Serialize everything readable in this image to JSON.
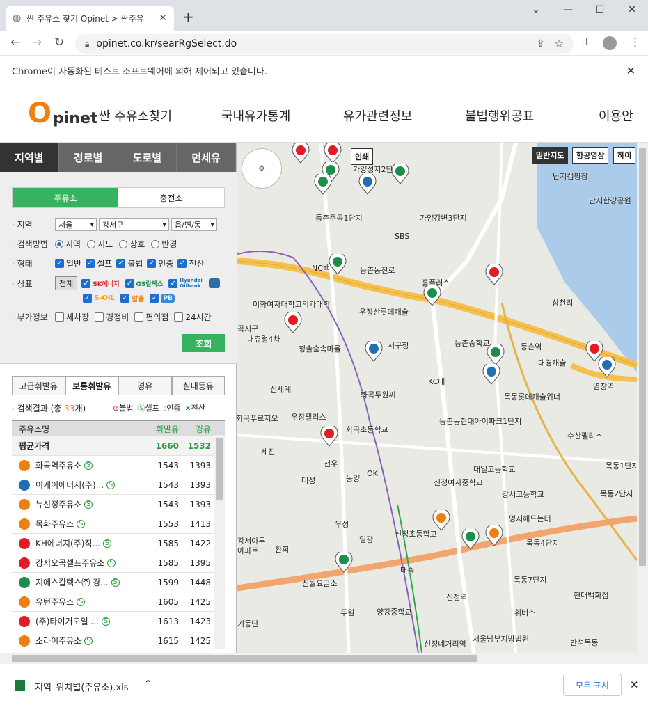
{
  "browser": {
    "tab_title": "싼 주유소 찾기 Opinet > 싼주유",
    "url": "opinet.co.kr/searRgSelect.do",
    "infobar": "Chrome이 자동화된 테스트 소프트웨어에 의해 제어되고 있습니다."
  },
  "header": {
    "logo_o": "O",
    "logo_rest": "pinet",
    "menu": [
      "싼 주유소찾기",
      "국내유가통계",
      "유가관련정보",
      "불법행위공표",
      "이용안"
    ]
  },
  "side": {
    "tabs": [
      "지역별",
      "경로별",
      "도로별",
      "면세유"
    ],
    "subtabs": [
      "주유소",
      "충전소"
    ],
    "region_label": "지역",
    "region_values": [
      "서울",
      "강서구",
      "읍/면/동"
    ],
    "method_label": "검색방법",
    "method_options": [
      "지역",
      "지도",
      "상호",
      "반경"
    ],
    "type_label": "형태",
    "type_options": [
      "일반",
      "셀프",
      "불법",
      "인증",
      "전산"
    ],
    "brand_label": "상표",
    "brand_all": "전체",
    "brands_row1": [
      "SK에너지",
      "GS칼텍스",
      "Hyundai Oilbank",
      ""
    ],
    "brands_row2": [
      "S-OIL",
      "알뜰",
      "PB"
    ],
    "extra_label": "부가정보",
    "extra_options": [
      "세차장",
      "경정비",
      "편의점",
      "24시간"
    ],
    "search_button": "조회",
    "fuel_tabs": [
      "고급휘발유",
      "보통휘발유",
      "경유",
      "실내등유"
    ],
    "result_prefix": "검색결과 (총 ",
    "result_count": "33",
    "result_suffix": "개)",
    "legend": [
      "불법",
      "셀프",
      "인증",
      "전산"
    ],
    "table_headers": [
      "주유소명",
      "휘발유",
      "경유"
    ],
    "avg_label": "평균가격",
    "avg_gas": "1660",
    "avg_diesel": "1532",
    "rows": [
      {
        "name": "화곡역주유소",
        "brand": "알뜰",
        "color": "#f07f11",
        "gas": "1543",
        "diesel": "1393"
      },
      {
        "name": "이케이에너지(주)...",
        "brand": "HD",
        "color": "#1f6fb2",
        "gas": "1543",
        "diesel": "1393"
      },
      {
        "name": "뉴신정주유소",
        "brand": "알뜰",
        "color": "#f07f11",
        "gas": "1543",
        "diesel": "1393"
      },
      {
        "name": "목화주유소",
        "brand": "알뜰",
        "color": "#f07f11",
        "gas": "1553",
        "diesel": "1413"
      },
      {
        "name": "KH에너지(주)직...",
        "brand": "SK",
        "color": "#e31b23",
        "gas": "1585",
        "diesel": "1422"
      },
      {
        "name": "강서오곡셀프주유소",
        "brand": "SK",
        "color": "#e31b23",
        "gas": "1585",
        "diesel": "1395"
      },
      {
        "name": "지에스칼텍스㈜ 경...",
        "brand": "GS",
        "color": "#1b8f4a",
        "gas": "1599",
        "diesel": "1448"
      },
      {
        "name": "유턴주유소",
        "brand": "알뜰",
        "color": "#f07f11",
        "gas": "1605",
        "diesel": "1425"
      },
      {
        "name": "(주)타이거오일 ...",
        "brand": "SK",
        "color": "#e31b23",
        "gas": "1613",
        "diesel": "1423"
      },
      {
        "name": "소라이주유소",
        "brand": "알뜰",
        "color": "#f07f11",
        "gas": "1615",
        "diesel": "1425"
      }
    ]
  },
  "map": {
    "type_buttons": [
      "일반지도",
      "항공영상",
      "하이"
    ],
    "print_button": "인쇄",
    "labels": [
      "가양성지2단",
      "난지캠핑장",
      "난지한강공원",
      "등촌주공1단지",
      "가양강변3단지",
      "SBS",
      "NC백",
      "등촌동진로",
      "홈플러스",
      "삼천리",
      "이화여자대학교의과대학",
      "우장산롯데캐슬",
      "내츄럴4차",
      "청솔숲속마을",
      "서구청",
      "등촌중학교",
      "등촌역",
      "대경캐슬",
      "염창역",
      "신세계",
      "KC대",
      "화곡푸르지오",
      "우장팰리스",
      "화곡두원씨",
      "목동롯데캐슬위너",
      "등촌동현대아이파크1단지",
      "수산팰리스",
      "화곡초등학교",
      "세진",
      "천우",
      "대성",
      "동양",
      "OK",
      "대일고등학교",
      "신정여자중학교",
      "강서고등학교",
      "목동1단지",
      "우성",
      "일광",
      "신정초등학교",
      "명지해드는터",
      "목동2단지",
      "목동4단지",
      "환희",
      "태승",
      "신월요금소",
      "목동7단지",
      "현대백화점",
      "두원",
      "양강중학교",
      "신정역",
      "휘버스",
      "신정네거리역",
      "서울남부지방법원",
      "반석목동",
      "기동단",
      "곡지구",
      "강서아루",
      "아파트"
    ]
  },
  "download": {
    "filename": "지역_위치별(주유소).xls",
    "show_all": "모두 표시"
  }
}
